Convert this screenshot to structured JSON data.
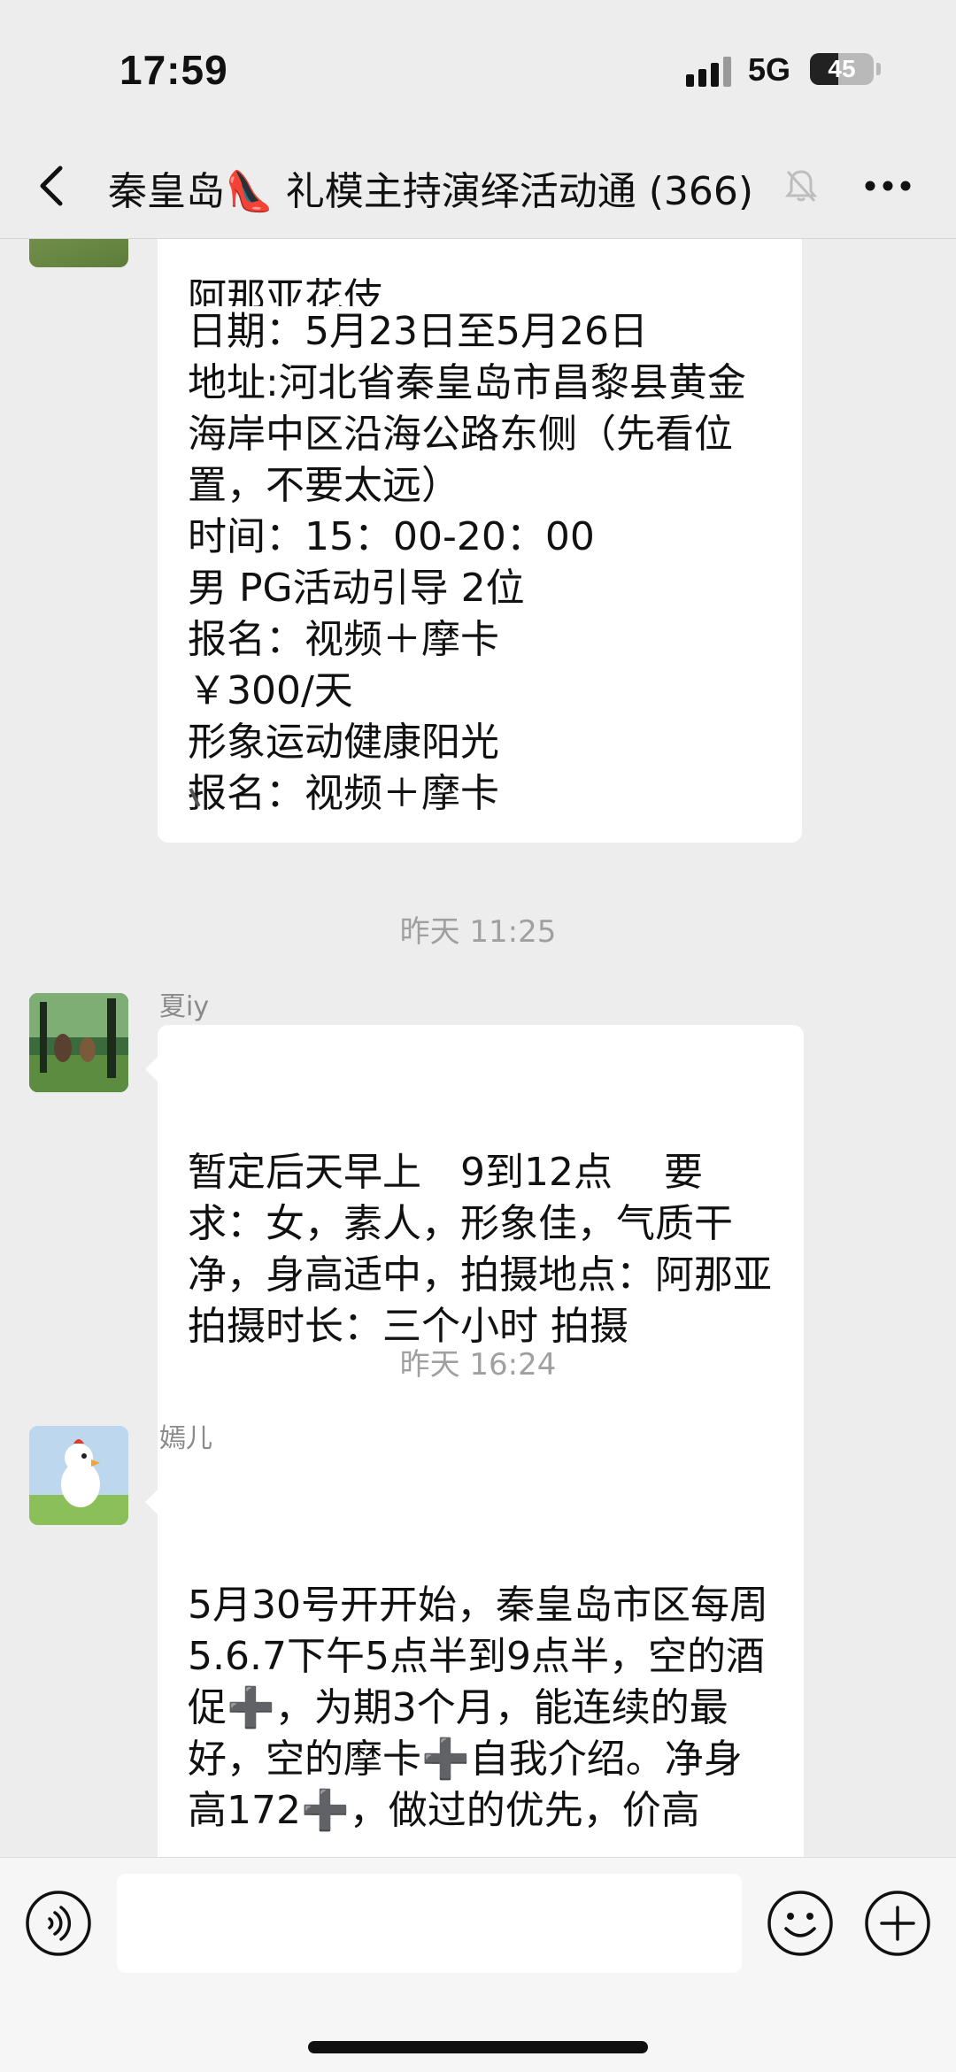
{
  "status_bar": {
    "time": "17:59",
    "network": "5G",
    "battery": "45",
    "battery_level_percent": 45
  },
  "header": {
    "title": "秦皇岛👠 礼模主持演绎活动通 (366)",
    "icons": [
      "back-icon",
      "mute-icon",
      "more-icon"
    ]
  },
  "messages": [
    {
      "type": "bubble",
      "partial_top_line": "阿那亚花伎",
      "text": "日期：5月23日至5月26日\n地址:河北省秦皇岛市昌黎县黄金海岸中区沿海公路东侧（先看位置，不要太远）\n时间：15：00-20：00\n男 PG活动引导 2位\n报名：视频＋摩卡\n￥300/天\n形象运动健康阳光\n报名：视频＋摩卡"
    },
    {
      "type": "time",
      "text": "昨天 11:25"
    },
    {
      "type": "bubble",
      "sender": "夏iy",
      "text": "暂定后天早上　9到12点　 要求：女，素人，形象佳，气质干净，身高适中，拍摄地点：阿那亚 拍摄时长：三个小时 拍摄"
    },
    {
      "type": "time",
      "text": "昨天 16:24"
    },
    {
      "type": "bubble",
      "sender": "嫣儿",
      "text": "5月30号开开始，秦皇岛市区每周5.6.7下午5点半到9点半，空的酒促➕，为期3个月，能连续的最好，空的摩卡➕自我介绍。净身高172➕，做过的优先，价高"
    }
  ],
  "input_bar": {
    "icons": [
      "voice-icon",
      "emoji-icon",
      "plus-icon"
    ],
    "value": ""
  },
  "colors": {
    "background": "#ededed",
    "bubble": "#ffffff",
    "timestamp": "#a0a0a0",
    "sender_name": "#8a8a8a"
  }
}
